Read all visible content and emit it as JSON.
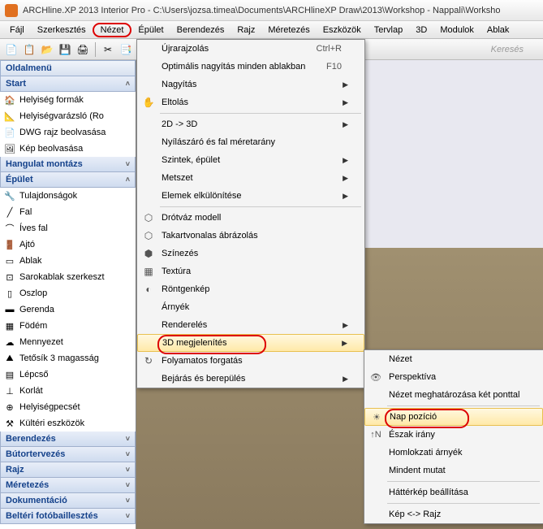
{
  "title": "ARCHline.XP 2013 Interior Pro - C:\\Users\\jozsa.timea\\Documents\\ARCHlineXP Draw\\2013\\Workshop - Nappali\\Worksho",
  "menubar": [
    "Fájl",
    "Szerkesztés",
    "Nézet",
    "Épület",
    "Berendezés",
    "Rajz",
    "Méretezés",
    "Eszközök",
    "Tervlap",
    "3D",
    "Modulok",
    "Ablak"
  ],
  "menubar_active_index": 2,
  "toolbar_search_placeholder": "Keresés",
  "sidebar": {
    "title": "Oldalmenü",
    "sections": [
      {
        "label": "Start",
        "items": [
          {
            "icon": "🏠",
            "label": "Helyiség formák"
          },
          {
            "icon": "📐",
            "label": "Helyiségvarázsló (Ro"
          },
          {
            "icon": "📄",
            "label": "DWG rajz beolvasása"
          },
          {
            "icon": "🖼",
            "label": "Kép beolvasása"
          }
        ]
      },
      {
        "label": "Hangulat montázs",
        "items": []
      },
      {
        "label": "Épület",
        "items": [
          {
            "icon": "🔧",
            "label": "Tulajdonságok"
          },
          {
            "icon": "╱",
            "label": "Fal"
          },
          {
            "icon": "⌒",
            "label": "Íves fal"
          },
          {
            "icon": "🚪",
            "label": "Ajtó"
          },
          {
            "icon": "▭",
            "label": "Ablak"
          },
          {
            "icon": "⊡",
            "label": "Sarokablak szerkeszt"
          },
          {
            "icon": "▯",
            "label": "Oszlop"
          },
          {
            "icon": "▬",
            "label": "Gerenda"
          },
          {
            "icon": "▦",
            "label": "Födém"
          },
          {
            "icon": "☁",
            "label": "Mennyezet"
          },
          {
            "icon": "⛰",
            "label": "Tetősík 3 magasság"
          },
          {
            "icon": "▤",
            "label": "Lépcső"
          },
          {
            "icon": "⊥",
            "label": "Korlát"
          },
          {
            "icon": "⊕",
            "label": "Helyiségpecsét"
          },
          {
            "icon": "⚒",
            "label": "Kültéri eszközök"
          }
        ]
      },
      {
        "label": "Berendezés",
        "items": []
      },
      {
        "label": "Bútortervezés",
        "items": []
      },
      {
        "label": "Rajz",
        "items": []
      },
      {
        "label": "Méretezés",
        "items": []
      },
      {
        "label": "Dokumentáció",
        "items": []
      },
      {
        "label": "Beltéri fotóbaillesztés",
        "items": []
      }
    ]
  },
  "dropdown": [
    {
      "type": "item",
      "icon": "",
      "label": "Újrarajzolás",
      "shortcut": "Ctrl+R"
    },
    {
      "type": "item",
      "icon": "",
      "label": "Optimális nagyítás minden ablakban",
      "shortcut": "F10"
    },
    {
      "type": "item",
      "icon": "",
      "label": "Nagyítás",
      "sub": true
    },
    {
      "type": "item",
      "icon": "✋",
      "label": "Eltolás",
      "sub": true
    },
    {
      "type": "sep"
    },
    {
      "type": "item",
      "icon": "",
      "label": "2D -> 3D",
      "sub": true
    },
    {
      "type": "item",
      "icon": "",
      "label": "Nyílászáró és fal méretarány"
    },
    {
      "type": "item",
      "icon": "",
      "label": "Szintek, épület",
      "sub": true
    },
    {
      "type": "item",
      "icon": "",
      "label": "Metszet",
      "sub": true
    },
    {
      "type": "item",
      "icon": "",
      "label": "Elemek elkülönítése",
      "sub": true
    },
    {
      "type": "sep"
    },
    {
      "type": "item",
      "icon": "⬡",
      "label": "Drótváz modell"
    },
    {
      "type": "item",
      "icon": "⬡",
      "label": "Takartvonalas ábrázolás"
    },
    {
      "type": "item",
      "icon": "⬢",
      "label": "Színezés"
    },
    {
      "type": "item",
      "icon": "▦",
      "label": "Textúra"
    },
    {
      "type": "item",
      "icon": "◐",
      "label": "Röntgenkép"
    },
    {
      "type": "item",
      "icon": "",
      "label": "Árnyék"
    },
    {
      "type": "item",
      "icon": "",
      "label": "Renderelés",
      "sub": true
    },
    {
      "type": "item",
      "icon": "",
      "label": "3D megjelenítés",
      "sub": true,
      "highlighted": true,
      "circled": true
    },
    {
      "type": "item",
      "icon": "↻",
      "label": "Folyamatos forgatás"
    },
    {
      "type": "item",
      "icon": "",
      "label": "Bejárás és berepülés",
      "sub": true
    }
  ],
  "submenu": [
    {
      "type": "item",
      "icon": "",
      "label": "Nézet"
    },
    {
      "type": "item",
      "icon": "👁",
      "label": "Perspektíva"
    },
    {
      "type": "item",
      "icon": "",
      "label": "Nézet meghatározása két ponttal"
    },
    {
      "type": "sep"
    },
    {
      "type": "item",
      "icon": "☀",
      "label": "Nap pozíció",
      "highlighted": true,
      "circled": true
    },
    {
      "type": "item",
      "icon": "↑N",
      "label": "Észak irány"
    },
    {
      "type": "item",
      "icon": "",
      "label": "Homlokzati árnyék"
    },
    {
      "type": "item",
      "icon": "",
      "label": "Mindent mutat"
    },
    {
      "type": "sep"
    },
    {
      "type": "item",
      "icon": "",
      "label": "Háttérkép beállítása"
    },
    {
      "type": "sep"
    },
    {
      "type": "item",
      "icon": "",
      "label": "Kép <-> Rajz"
    }
  ]
}
